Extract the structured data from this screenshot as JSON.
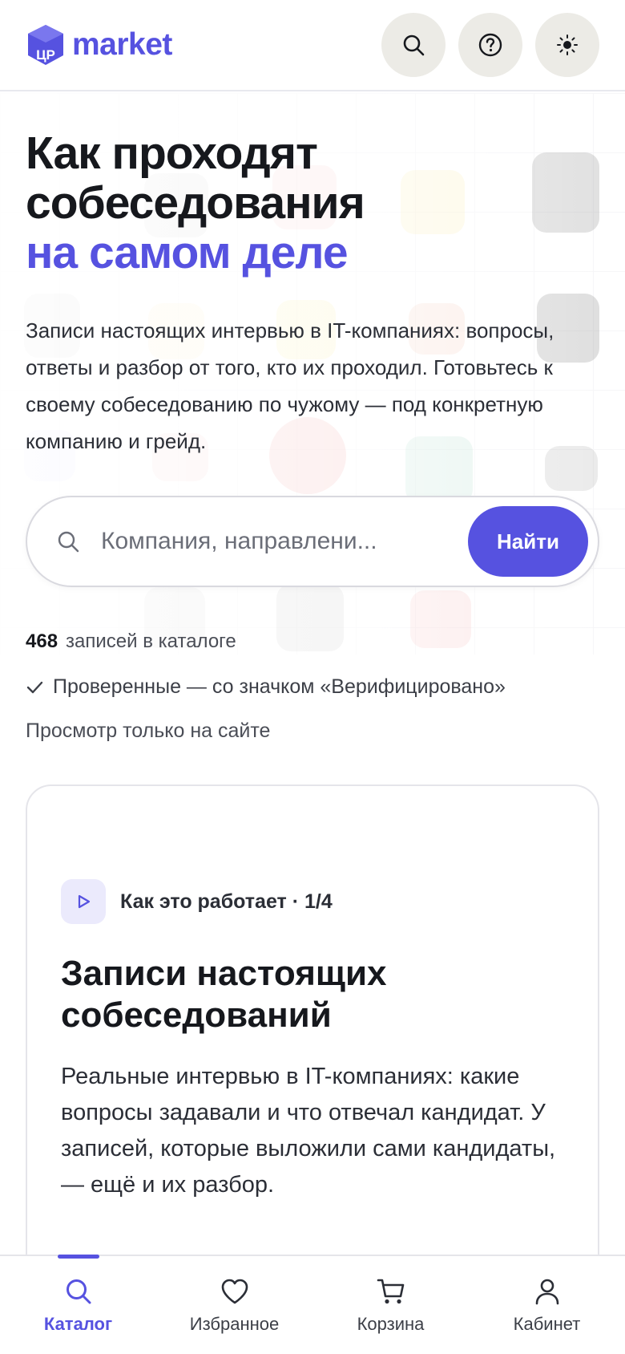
{
  "header": {
    "logo_mark": "ЦР",
    "logo_text": "market",
    "brand_color": "#5652e0",
    "icons": [
      "search-icon",
      "help-icon",
      "theme-sun-icon"
    ]
  },
  "hero": {
    "title_line1": "Как проходят",
    "title_line2": "собеседования",
    "title_accent": "на самом деле",
    "description": "Записи настоящих интервью в IT-компаниях: вопросы, ответы и разбор от того, кто их проходил. Готовьтесь к своему собеседованию по чужому — под конкретную компанию и грейд."
  },
  "search": {
    "placeholder": "Компания, направлени...",
    "value": "",
    "button_label": "Найти"
  },
  "stats": {
    "count": "468",
    "count_label": "записей в каталоге",
    "verified_text": "Проверенные — со значком «Верифицировано»",
    "view_only_text": "Просмотр только на сайте"
  },
  "card": {
    "step_label": "Как это работает · 1/4",
    "title": "Записи настоящих собеседований",
    "text": "Реальные интервью в IT-компаниях: какие вопросы задавали и что отвечал кандидат. У записей, которые выложили сами кандидаты, — ещё и их разбор."
  },
  "bottom_nav": {
    "items": [
      {
        "label": "Каталог",
        "icon": "search-icon",
        "active": true
      },
      {
        "label": "Избранное",
        "icon": "heart-icon",
        "active": false
      },
      {
        "label": "Корзина",
        "icon": "cart-icon",
        "active": false
      },
      {
        "label": "Кабинет",
        "icon": "user-icon",
        "active": false
      }
    ]
  }
}
